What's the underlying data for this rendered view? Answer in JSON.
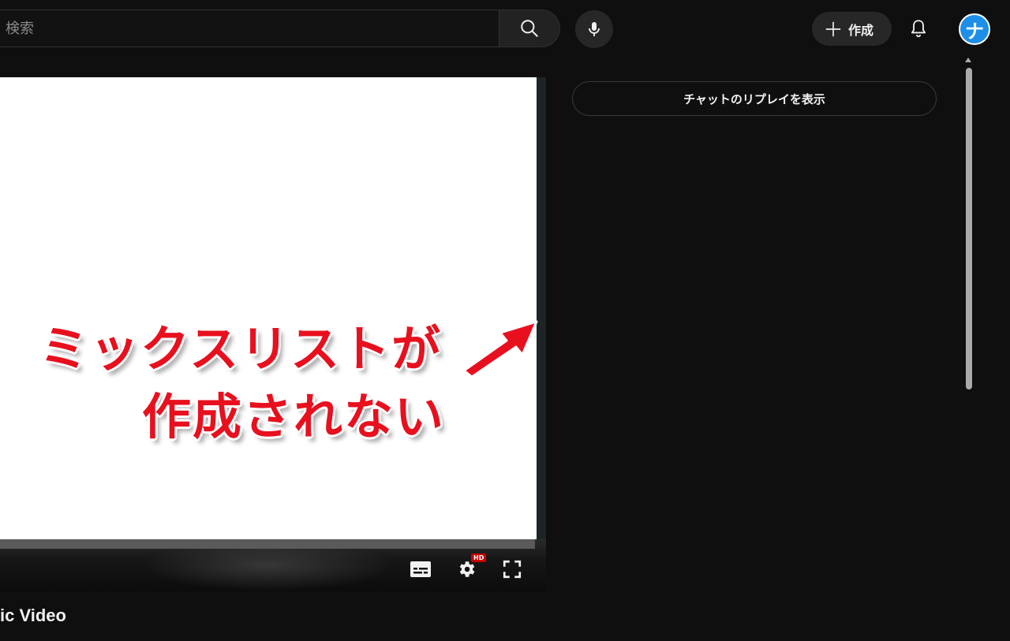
{
  "header": {
    "search_placeholder": "検索",
    "create_label": "作成",
    "avatar_letter": "ナ"
  },
  "player": {
    "annotation_line1": "ミックスリストが",
    "annotation_line2": "作成されない",
    "hd_badge": "HD",
    "annotation_color": "#e8101e"
  },
  "video": {
    "title_fragment": "ic Video"
  },
  "chat": {
    "replay_label": "チャットのリプレイを表示"
  },
  "icons": [
    "search-icon",
    "mic-icon",
    "plus-icon",
    "bell-icon",
    "subtitles-icon",
    "settings-icon",
    "fullscreen-icon",
    "arrow-icon"
  ]
}
